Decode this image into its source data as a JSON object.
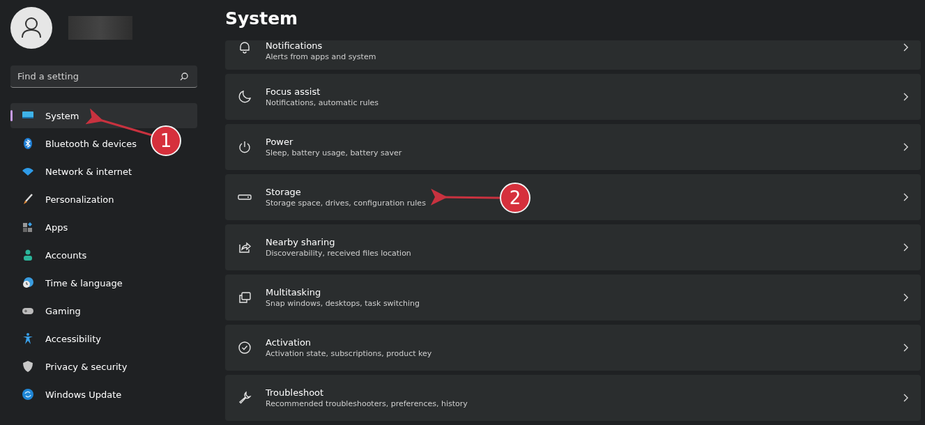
{
  "search": {
    "placeholder": "Find a setting"
  },
  "nav": [
    {
      "label": "System",
      "selected": true
    },
    {
      "label": "Bluetooth & devices",
      "selected": false
    },
    {
      "label": "Network & internet",
      "selected": false
    },
    {
      "label": "Personalization",
      "selected": false
    },
    {
      "label": "Apps",
      "selected": false
    },
    {
      "label": "Accounts",
      "selected": false
    },
    {
      "label": "Time & language",
      "selected": false
    },
    {
      "label": "Gaming",
      "selected": false
    },
    {
      "label": "Accessibility",
      "selected": false
    },
    {
      "label": "Privacy & security",
      "selected": false
    },
    {
      "label": "Windows Update",
      "selected": false
    }
  ],
  "page_title": "System",
  "settings": [
    {
      "title": "Notifications",
      "subtitle": "Alerts from apps and system"
    },
    {
      "title": "Focus assist",
      "subtitle": "Notifications, automatic rules"
    },
    {
      "title": "Power",
      "subtitle": "Sleep, battery usage, battery saver"
    },
    {
      "title": "Storage",
      "subtitle": "Storage space, drives, configuration rules"
    },
    {
      "title": "Nearby sharing",
      "subtitle": "Discoverability, received files location"
    },
    {
      "title": "Multitasking",
      "subtitle": "Snap windows, desktops, task switching"
    },
    {
      "title": "Activation",
      "subtitle": "Activation state, subscriptions, product key"
    },
    {
      "title": "Troubleshoot",
      "subtitle": "Recommended troubleshooters, preferences, history"
    }
  ],
  "annotations": [
    {
      "label": "1"
    },
    {
      "label": "2"
    }
  ]
}
